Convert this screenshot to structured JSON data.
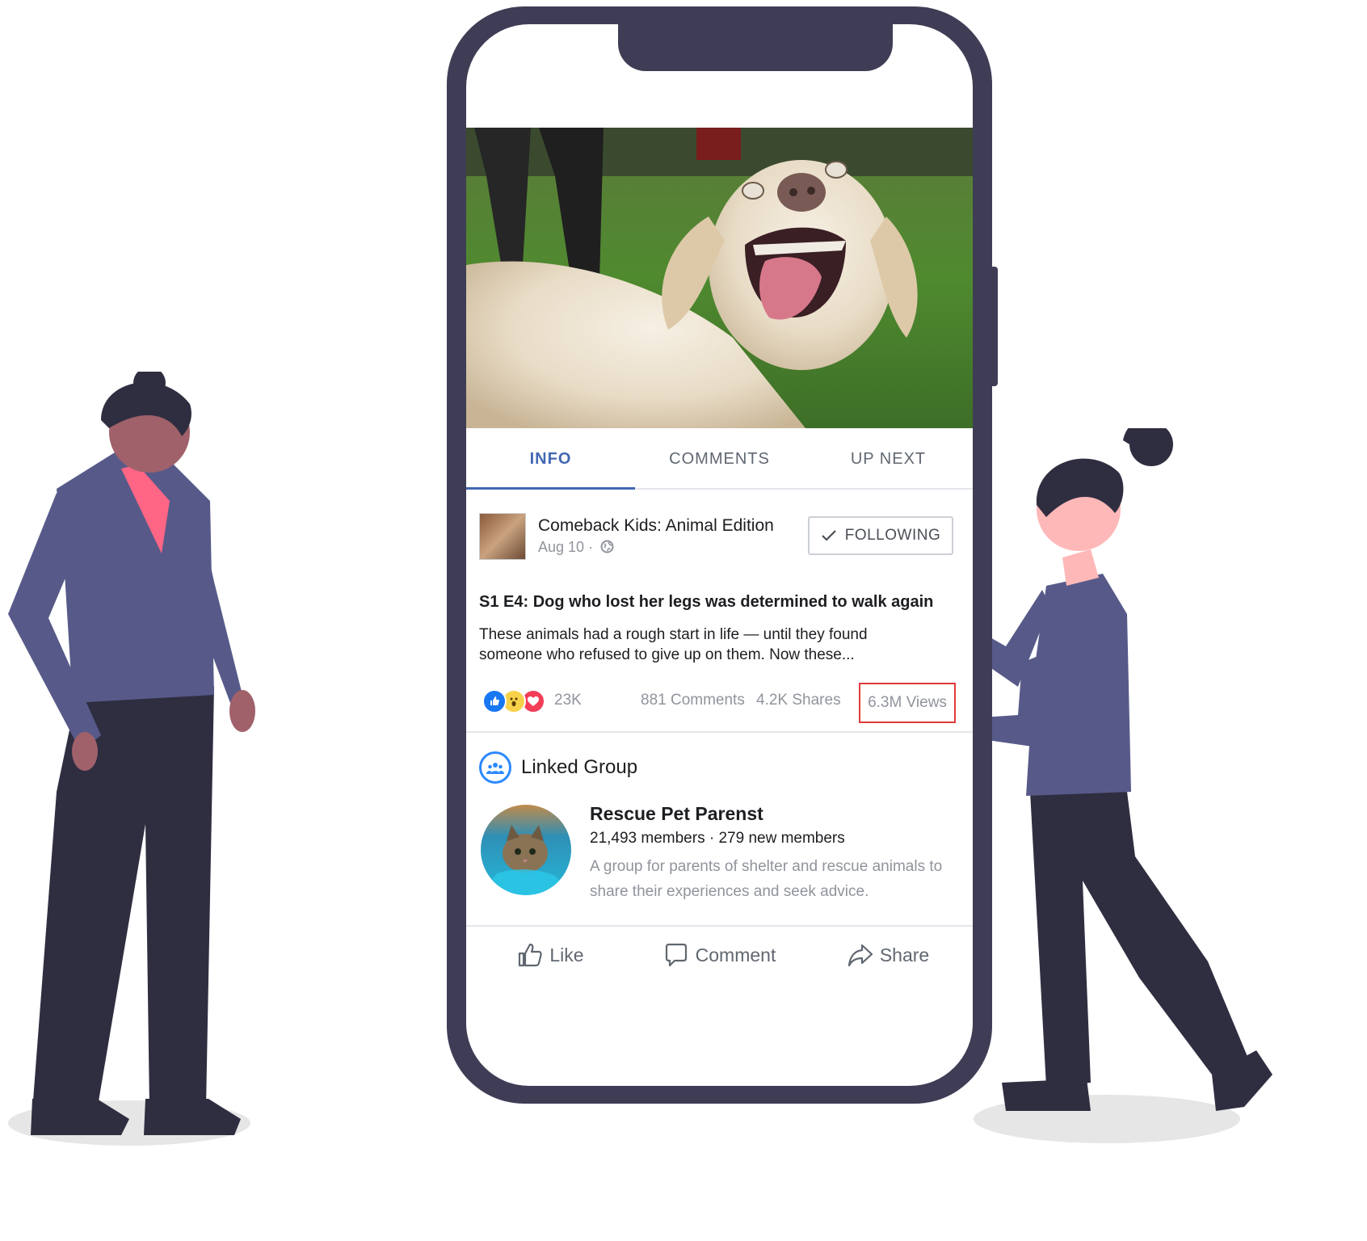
{
  "tabs": [
    {
      "label": "INFO",
      "active": true
    },
    {
      "label": "COMMENTS",
      "active": false
    },
    {
      "label": "UP NEXT",
      "active": false
    }
  ],
  "post": {
    "page_name": "Comeback Kids: Animal Edition",
    "date": "Aug 10 ·",
    "follow_label": "FOLLOWING",
    "title": "S1 E4: Dog who lost her legs was determined to walk again",
    "description": "These animals had a rough start in life — until they found someone who refused to give up on them. Now these...",
    "reactions_count": "23K",
    "comments": "881 Comments",
    "shares": "4.2K Shares",
    "views": "6.3M Views"
  },
  "linked_group": {
    "section_label": "Linked Group",
    "name": "Rescue Pet Parenst",
    "members": "21,493 members · 279 new members",
    "description": "A group for parents of shelter and rescue animals to share their experiences and seek advice."
  },
  "actions": {
    "like": "Like",
    "comment": "Comment",
    "share": "Share"
  },
  "colors": {
    "phone_frame": "#3f3d56",
    "accent": "#4267b2",
    "highlight_box": "#e03b3b",
    "person_shirt": "#575a89",
    "person_pants": "#2f2e41"
  }
}
